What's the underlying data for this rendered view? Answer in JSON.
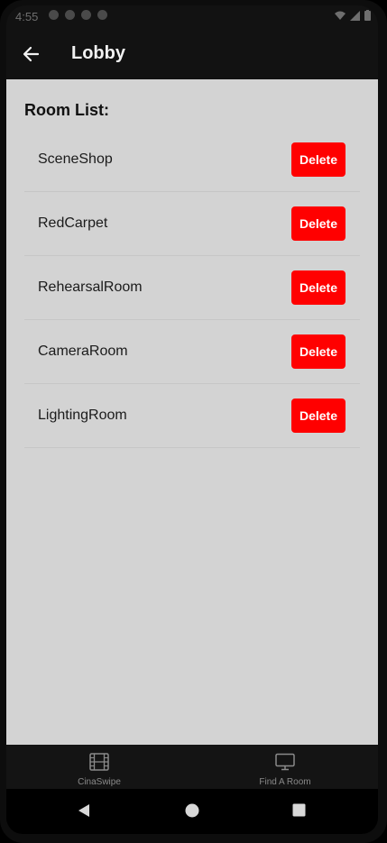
{
  "status_bar": {
    "time": "4:55"
  },
  "app_bar": {
    "title": "Lobby"
  },
  "room_list": {
    "heading": "Room List:",
    "delete_label": "Delete",
    "rooms": [
      {
        "name": "SceneShop"
      },
      {
        "name": "RedCarpet"
      },
      {
        "name": "RehearsalRoom"
      },
      {
        "name": "CameraRoom"
      },
      {
        "name": "LightingRoom"
      }
    ]
  },
  "bottom_nav": {
    "items": [
      {
        "label": "CinaSwipe",
        "icon": "film-icon"
      },
      {
        "label": "Find A Room",
        "icon": "monitor-icon"
      }
    ]
  },
  "colors": {
    "delete_button": "#ff0000",
    "content_background": "#d3d3d3",
    "app_bar": "#121212"
  }
}
